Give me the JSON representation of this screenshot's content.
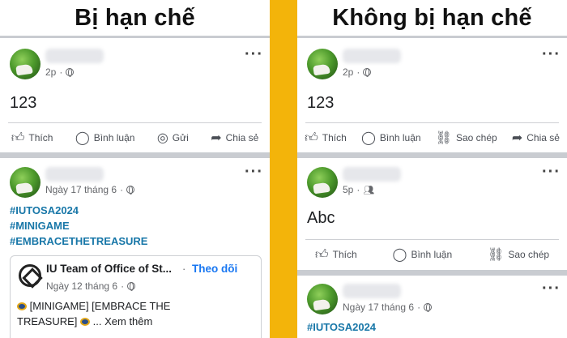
{
  "left": {
    "heading": "Bị hạn chế",
    "post1": {
      "time": "2p",
      "text": "123",
      "actions": [
        "Thích",
        "Bình luận",
        "Gửi",
        "Chia sẻ"
      ]
    },
    "post2": {
      "time": "Ngày 17 tháng 6",
      "tags": [
        "#IUTOSA2024",
        "#MINIGAME",
        "#EMBRACETHETREASURE"
      ],
      "shared": {
        "page_name": "IU Team of Office of St...",
        "separator": "·",
        "follow": "Theo dõi",
        "time": "Ngày 12 tháng 6",
        "text": "[MINIGAME] [EMBRACE THE TREASURE]",
        "more": "... Xem thêm"
      }
    }
  },
  "right": {
    "heading": "Không bị hạn chế",
    "post1": {
      "time": "2p",
      "text": "123",
      "actions": [
        "Thích",
        "Bình luận",
        "Sao chép",
        "Chia sẻ"
      ]
    },
    "post2": {
      "time": "5p",
      "text": "Abc",
      "actions": [
        "Thích",
        "Bình luận",
        "Sao chép"
      ]
    },
    "post3": {
      "time": "Ngày 17 tháng 6",
      "tags": [
        "#IUTOSA2024"
      ]
    }
  },
  "colors": {
    "divider": "#f3b40a",
    "hashtag": "#1877a8",
    "follow": "#1877f2"
  },
  "icons": {
    "like": "thumbs-up-icon",
    "comment": "comment-bubble-icon",
    "send": "messenger-icon",
    "share": "share-arrow-icon",
    "copy": "link-icon",
    "more": "more-dots-icon",
    "audience_public": "globe-icon",
    "audience_friends": "friends-icon"
  }
}
